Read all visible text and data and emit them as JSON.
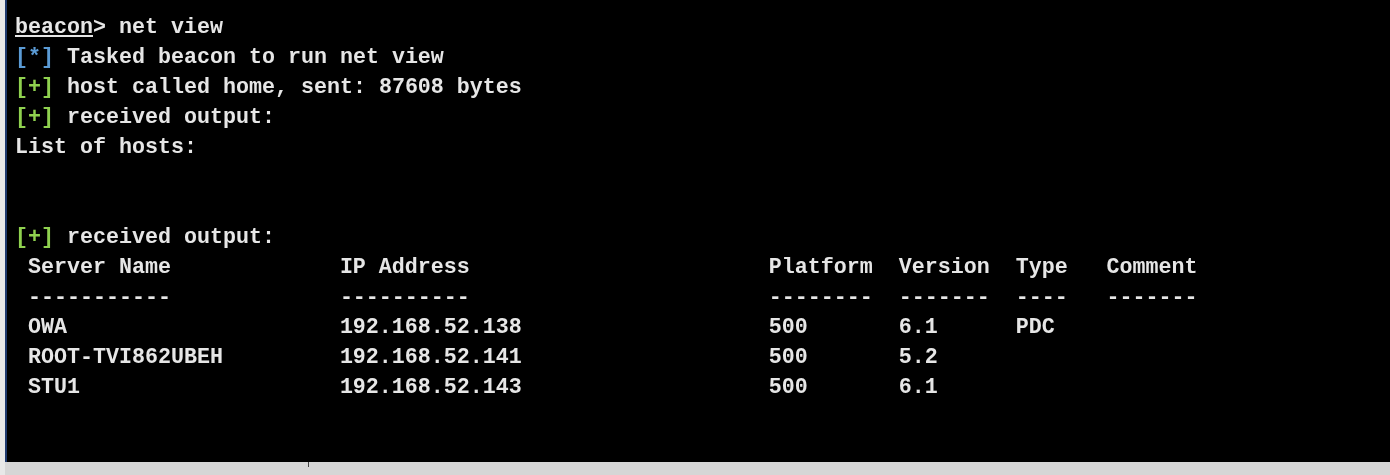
{
  "prompt": {
    "name": "beacon",
    "symbol": ">",
    "command": "net view"
  },
  "lines": [
    {
      "kind": "task",
      "marker": "[*]",
      "text": "Tasked beacon to run net view"
    },
    {
      "kind": "success",
      "marker": "[+]",
      "text": "host called home, sent: 87608 bytes"
    },
    {
      "kind": "success",
      "marker": "[+]",
      "text": "received output:"
    },
    {
      "kind": "plain",
      "text": "List of hosts:"
    },
    {
      "kind": "blank"
    },
    {
      "kind": "blank"
    },
    {
      "kind": "success",
      "marker": "[+]",
      "text": "received output:"
    }
  ],
  "table": {
    "columns": [
      "Server Name",
      "IP Address",
      "Platform",
      "Version",
      "Type",
      "Comment"
    ],
    "rules": [
      "-----------",
      "----------",
      "--------",
      "-------",
      "----",
      "-------"
    ],
    "rows": [
      [
        "OWA",
        "192.168.52.138",
        "500",
        "6.1",
        "PDC",
        ""
      ],
      [
        "ROOT-TVI862UBEH",
        "192.168.52.141",
        "500",
        "5.2",
        "",
        ""
      ],
      [
        "STU1",
        "192.168.52.143",
        "500",
        "6.1",
        "",
        ""
      ]
    ]
  }
}
